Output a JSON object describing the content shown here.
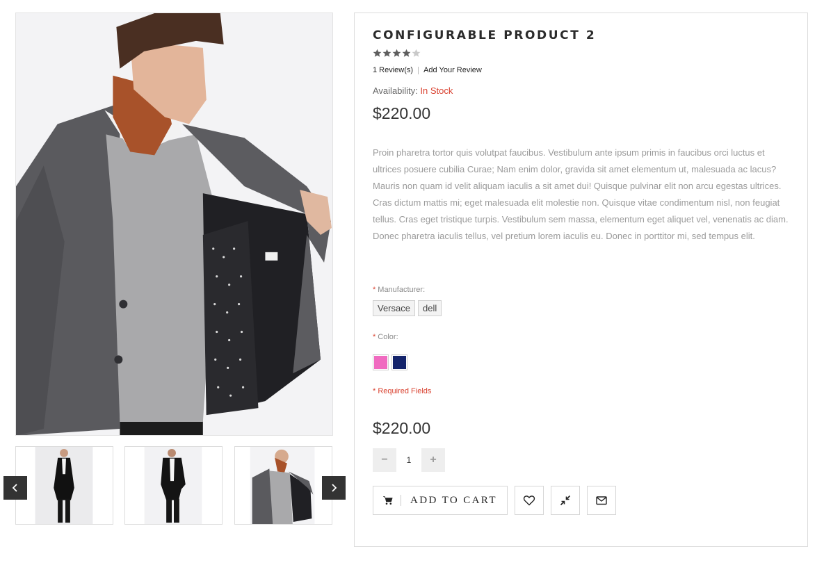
{
  "product": {
    "title": "CONFIGURABLE PRODUCT 2",
    "rating": 4,
    "rating_max": 5,
    "reviews_label": "1 Review(s)",
    "add_review_label": "Add Your Review",
    "availability_label": "Availability:",
    "availability_value": "In Stock",
    "price": "$220.00",
    "description": "Proin pharetra tortor quis volutpat faucibus. Vestibulum ante ipsum primis in faucibus orci luctus et ultrices posuere cubilia Curae; Nam enim dolor, gravida sit amet elementum ut, malesuada ac lacus? Mauris non quam id velit aliquam iaculis a sit amet dui! Quisque pulvinar elit non arcu egestas ultrices. Cras dictum mattis mi; eget malesuada elit molestie non. Quisque vitae condimentum nisl, non feugiat tellus. Cras eget tristique turpis. Vestibulum sem massa, elementum eget aliquet vel, venenatis ac diam. Donec pharetra iaculis tellus, vel pretium lorem iaculis eu. Donec in porttitor mi, sed tempus elit.",
    "price_final": "$220.00"
  },
  "options": {
    "required_mark": "*",
    "manufacturer_label": "Manufacturer:",
    "manufacturer_values": [
      "Versace",
      "dell"
    ],
    "color_label": "Color:",
    "colors": [
      "#f06ac0",
      "#14246b"
    ],
    "required_fields": "* Required Fields"
  },
  "quantity": {
    "value": "1",
    "minus_label": "−",
    "plus_label": "+"
  },
  "actions": {
    "add_to_cart": "ADD TO CART",
    "cart_icon": "shopping-cart-icon",
    "wishlist_icon": "heart-icon",
    "compare_icon": "compress-arrows-icon",
    "email_icon": "envelope-icon"
  },
  "gallery": {
    "prev_icon": "chevron-left-icon",
    "next_icon": "chevron-right-icon",
    "thumbnail_count": 3
  },
  "colors": {
    "accent_red": "#d9412f",
    "dark": "#333333"
  }
}
